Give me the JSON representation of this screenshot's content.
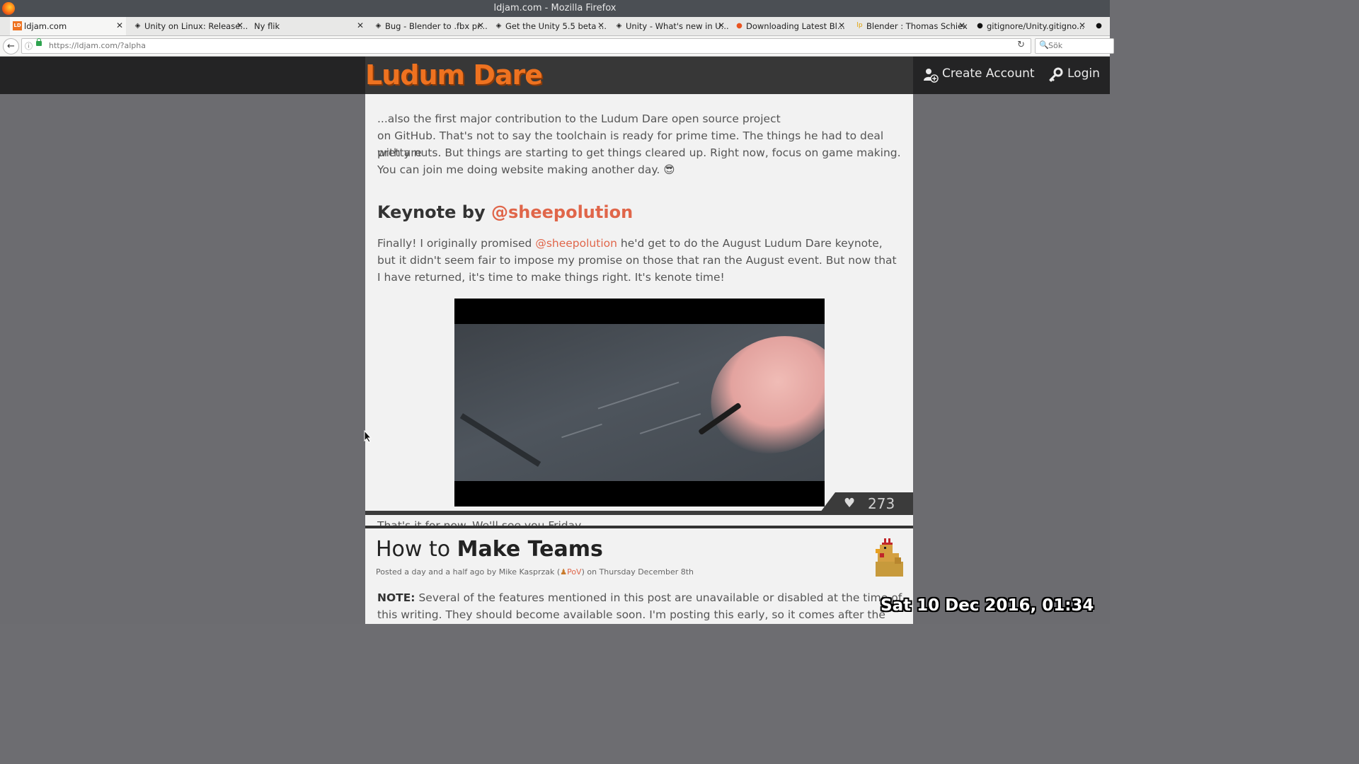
{
  "window": {
    "title": "ldjam.com - Mozilla Firefox"
  },
  "tabs": [
    {
      "label": "ldjam.com",
      "icon": "ludumdare-favicon"
    },
    {
      "label": "Unity on Linux: Release...",
      "icon": "unity-favicon"
    },
    {
      "label": "Ny flik",
      "icon": ""
    },
    {
      "label": "Bug - Blender to .fbx pr...",
      "icon": "unity-favicon"
    },
    {
      "label": "Get the Unity 5.5 beta ...",
      "icon": "unity-favicon"
    },
    {
      "label": "Unity - What's new in U...",
      "icon": "unity-favicon"
    },
    {
      "label": "Downloading Latest Bl...",
      "icon": "askubuntu-favicon"
    },
    {
      "label": "Blender : Thomas Schiex",
      "icon": "launchpad-favicon"
    },
    {
      "label": "gitignore/Unity.gitigno...",
      "icon": "github-favicon"
    }
  ],
  "nav": {
    "url": "https://ldjam.com/?alpha",
    "search_placeholder": "Sök"
  },
  "site": {
    "logo": "Ludum Dare",
    "create_account": "Create Account",
    "login": "Login"
  },
  "post1": {
    "fragment_top": "...also the first major contribution to the Ludum Dare open source project",
    "fragment_line2": "on GitHub. That's not to say the toolchain is ready for prime time. The things he had to deal with are",
    "para_intro": "pretty nuts. But things are starting to get things cleared up. Right now, focus on game making. You can join me doing website making another day. ",
    "emoji": "😎",
    "keynote_prefix": "Keynote by ",
    "keynote_mention": "@sheepolution",
    "keynote_p1": "Finally! I originally promised ",
    "keynote_p1_mention": "@sheepolution",
    "keynote_p1_rest": " he'd get to do the August Ludum Dare keynote, but it didn't seem fair to impose my promise on those that ran the August event. But now that I have returned, it's time to make things right. It's kenote time!",
    "outro": "That's it for now. We'll see you Friday.",
    "likes": "273"
  },
  "post2": {
    "title_light": "How to ",
    "title_bold": "Make Teams",
    "meta_before": "Posted a day and a half ago by Mike Kasprzak (",
    "meta_pov": "PoV",
    "meta_after": ") on Thursday December 8th",
    "note_label": "NOTE:",
    "note_text": " Several of the features mentioned in this post are unavailable or disabled at the time of this writing. They should become available soon. I'm posting this early, so it comes after the welcome post."
  },
  "overlay": {
    "clock": "Sat 10 Dec 2016, 01:34"
  },
  "colors": {
    "accent": "#e0664a",
    "logo": "#ee7220",
    "header": "#181818"
  }
}
